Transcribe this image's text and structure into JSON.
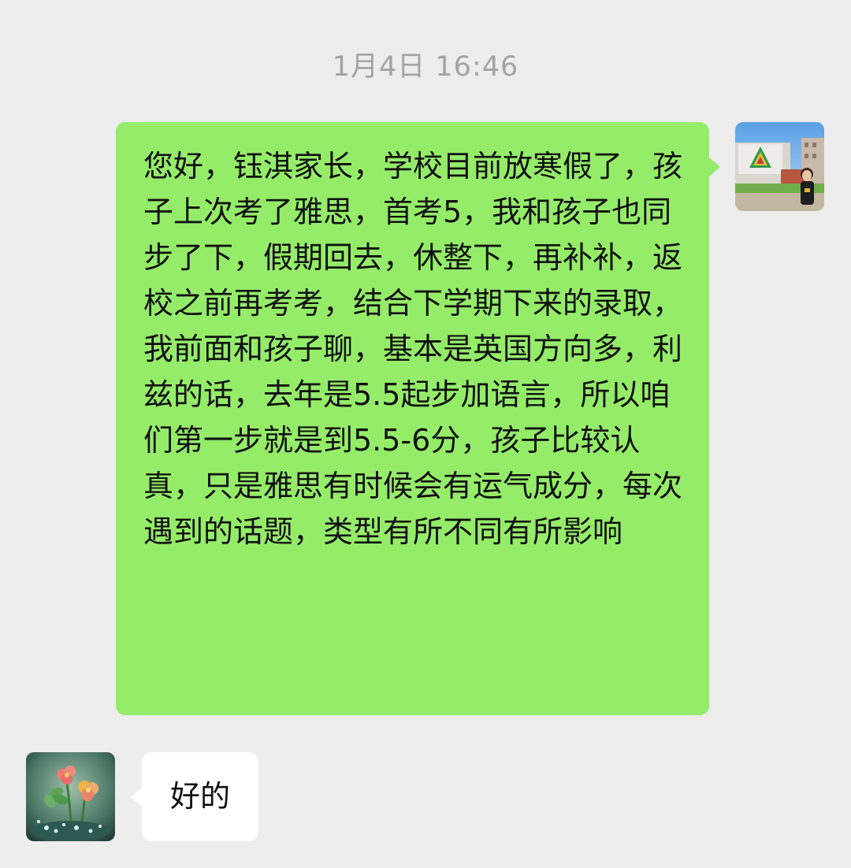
{
  "chat": {
    "timestamp": "1月4日 16:46",
    "messages": [
      {
        "sender": "self",
        "avatar_icon": "school-photo-avatar-icon",
        "text": "您好，钰淇家长，学校目前放寒假了，孩子上次考了雅思，首考5，我和孩子也同步了下，假期回去，休整下，再补补，返校之前再考考，结合下学期下来的录取，我前面和孩子聊，基本是英国方向多，利兹的话，去年是5.5起步加语言，所以咱们第一步就是到5.5-6分，孩子比较认真，只是雅思有时候会有运气成分，每次遇到的话题，类型有所不同有所影响"
      },
      {
        "sender": "other",
        "avatar_icon": "flower-avatar-icon",
        "text": "好的"
      }
    ]
  },
  "colors": {
    "background": "#ededed",
    "self_bubble": "#95ec69",
    "other_bubble": "#ffffff",
    "timestamp_text": "#a3a3a3"
  }
}
